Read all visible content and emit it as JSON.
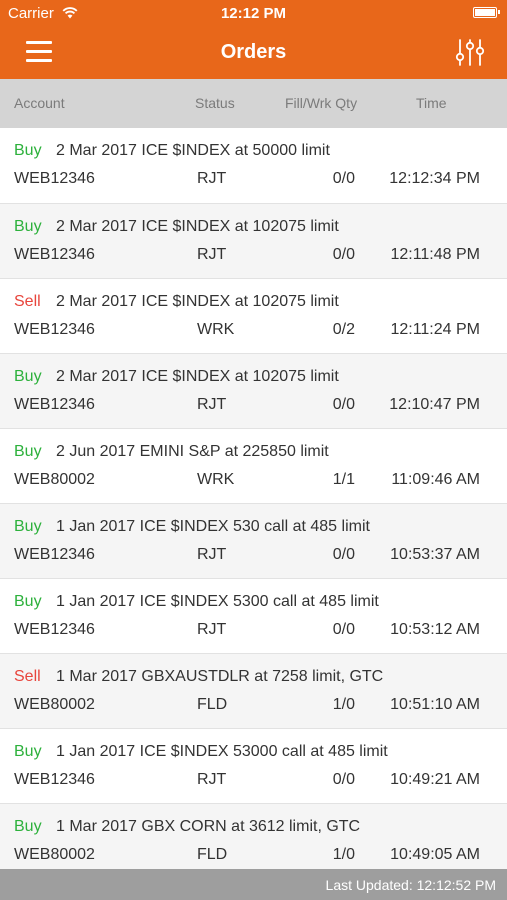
{
  "status_bar": {
    "carrier": "Carrier",
    "time": "12:12 PM"
  },
  "navbar": {
    "title": "Orders"
  },
  "columns": {
    "account": "Account",
    "status": "Status",
    "qty": "Fill/Wrk Qty",
    "time": "Time"
  },
  "orders": [
    {
      "side": "Buy",
      "desc": "2 Mar 2017 ICE $INDEX at 50000 limit",
      "account": "WEB12346",
      "status": "RJT",
      "qty": "0/0",
      "time": "12:12:34 PM"
    },
    {
      "side": "Buy",
      "desc": "2 Mar 2017 ICE $INDEX at 102075 limit",
      "account": "WEB12346",
      "status": "RJT",
      "qty": "0/0",
      "time": "12:11:48 PM"
    },
    {
      "side": "Sell",
      "desc": "2 Mar 2017 ICE $INDEX at 102075 limit",
      "account": "WEB12346",
      "status": "WRK",
      "qty": "0/2",
      "time": "12:11:24 PM"
    },
    {
      "side": "Buy",
      "desc": "2 Mar 2017 ICE $INDEX at 102075 limit",
      "account": "WEB12346",
      "status": "RJT",
      "qty": "0/0",
      "time": "12:10:47 PM"
    },
    {
      "side": "Buy",
      "desc": "2 Jun 2017 EMINI S&P at 225850 limit",
      "account": "WEB80002",
      "status": "WRK",
      "qty": "1/1",
      "time": "11:09:46 AM"
    },
    {
      "side": "Buy",
      "desc": "1 Jan 2017 ICE $INDEX 530 call at 485 limit",
      "account": "WEB12346",
      "status": "RJT",
      "qty": "0/0",
      "time": "10:53:37 AM"
    },
    {
      "side": "Buy",
      "desc": "1 Jan 2017 ICE $INDEX 5300 call at 485 limit",
      "account": "WEB12346",
      "status": "RJT",
      "qty": "0/0",
      "time": "10:53:12 AM"
    },
    {
      "side": "Sell",
      "desc": "1 Mar 2017 GBXAUSTDLR at 7258 limit, GTC",
      "account": "WEB80002",
      "status": "FLD",
      "qty": "1/0",
      "time": "10:51:10 AM"
    },
    {
      "side": "Buy",
      "desc": "1 Jan 2017 ICE $INDEX 53000 call at 485 limit",
      "account": "WEB12346",
      "status": "RJT",
      "qty": "0/0",
      "time": "10:49:21 AM"
    },
    {
      "side": "Buy",
      "desc": "1 Mar 2017 GBX CORN at 3612 limit, GTC",
      "account": "WEB80002",
      "status": "FLD",
      "qty": "1/0",
      "time": "10:49:05 AM"
    }
  ],
  "footer": {
    "last_updated": "Last Updated: 12:12:52 PM"
  },
  "colors": {
    "brand": "#e8671a",
    "buy": "#2db13c",
    "sell": "#e8453c"
  },
  "icons": {
    "menu": "hamburger-menu-icon",
    "filter": "sliders-filter-icon",
    "wifi": "wifi-icon",
    "battery": "battery-icon"
  }
}
